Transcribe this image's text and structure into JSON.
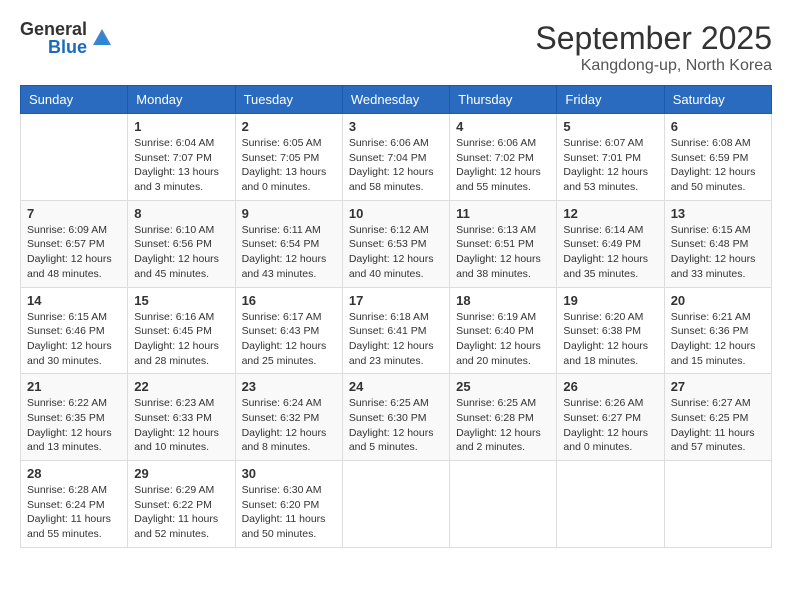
{
  "header": {
    "logo_general": "General",
    "logo_blue": "Blue",
    "month": "September 2025",
    "location": "Kangdong-up, North Korea"
  },
  "days_of_week": [
    "Sunday",
    "Monday",
    "Tuesday",
    "Wednesday",
    "Thursday",
    "Friday",
    "Saturday"
  ],
  "weeks": [
    [
      {
        "day": "",
        "info": ""
      },
      {
        "day": "1",
        "info": "Sunrise: 6:04 AM\nSunset: 7:07 PM\nDaylight: 13 hours\nand 3 minutes."
      },
      {
        "day": "2",
        "info": "Sunrise: 6:05 AM\nSunset: 7:05 PM\nDaylight: 13 hours\nand 0 minutes."
      },
      {
        "day": "3",
        "info": "Sunrise: 6:06 AM\nSunset: 7:04 PM\nDaylight: 12 hours\nand 58 minutes."
      },
      {
        "day": "4",
        "info": "Sunrise: 6:06 AM\nSunset: 7:02 PM\nDaylight: 12 hours\nand 55 minutes."
      },
      {
        "day": "5",
        "info": "Sunrise: 6:07 AM\nSunset: 7:01 PM\nDaylight: 12 hours\nand 53 minutes."
      },
      {
        "day": "6",
        "info": "Sunrise: 6:08 AM\nSunset: 6:59 PM\nDaylight: 12 hours\nand 50 minutes."
      }
    ],
    [
      {
        "day": "7",
        "info": "Sunrise: 6:09 AM\nSunset: 6:57 PM\nDaylight: 12 hours\nand 48 minutes."
      },
      {
        "day": "8",
        "info": "Sunrise: 6:10 AM\nSunset: 6:56 PM\nDaylight: 12 hours\nand 45 minutes."
      },
      {
        "day": "9",
        "info": "Sunrise: 6:11 AM\nSunset: 6:54 PM\nDaylight: 12 hours\nand 43 minutes."
      },
      {
        "day": "10",
        "info": "Sunrise: 6:12 AM\nSunset: 6:53 PM\nDaylight: 12 hours\nand 40 minutes."
      },
      {
        "day": "11",
        "info": "Sunrise: 6:13 AM\nSunset: 6:51 PM\nDaylight: 12 hours\nand 38 minutes."
      },
      {
        "day": "12",
        "info": "Sunrise: 6:14 AM\nSunset: 6:49 PM\nDaylight: 12 hours\nand 35 minutes."
      },
      {
        "day": "13",
        "info": "Sunrise: 6:15 AM\nSunset: 6:48 PM\nDaylight: 12 hours\nand 33 minutes."
      }
    ],
    [
      {
        "day": "14",
        "info": "Sunrise: 6:15 AM\nSunset: 6:46 PM\nDaylight: 12 hours\nand 30 minutes."
      },
      {
        "day": "15",
        "info": "Sunrise: 6:16 AM\nSunset: 6:45 PM\nDaylight: 12 hours\nand 28 minutes."
      },
      {
        "day": "16",
        "info": "Sunrise: 6:17 AM\nSunset: 6:43 PM\nDaylight: 12 hours\nand 25 minutes."
      },
      {
        "day": "17",
        "info": "Sunrise: 6:18 AM\nSunset: 6:41 PM\nDaylight: 12 hours\nand 23 minutes."
      },
      {
        "day": "18",
        "info": "Sunrise: 6:19 AM\nSunset: 6:40 PM\nDaylight: 12 hours\nand 20 minutes."
      },
      {
        "day": "19",
        "info": "Sunrise: 6:20 AM\nSunset: 6:38 PM\nDaylight: 12 hours\nand 18 minutes."
      },
      {
        "day": "20",
        "info": "Sunrise: 6:21 AM\nSunset: 6:36 PM\nDaylight: 12 hours\nand 15 minutes."
      }
    ],
    [
      {
        "day": "21",
        "info": "Sunrise: 6:22 AM\nSunset: 6:35 PM\nDaylight: 12 hours\nand 13 minutes."
      },
      {
        "day": "22",
        "info": "Sunrise: 6:23 AM\nSunset: 6:33 PM\nDaylight: 12 hours\nand 10 minutes."
      },
      {
        "day": "23",
        "info": "Sunrise: 6:24 AM\nSunset: 6:32 PM\nDaylight: 12 hours\nand 8 minutes."
      },
      {
        "day": "24",
        "info": "Sunrise: 6:25 AM\nSunset: 6:30 PM\nDaylight: 12 hours\nand 5 minutes."
      },
      {
        "day": "25",
        "info": "Sunrise: 6:25 AM\nSunset: 6:28 PM\nDaylight: 12 hours\nand 2 minutes."
      },
      {
        "day": "26",
        "info": "Sunrise: 6:26 AM\nSunset: 6:27 PM\nDaylight: 12 hours\nand 0 minutes."
      },
      {
        "day": "27",
        "info": "Sunrise: 6:27 AM\nSunset: 6:25 PM\nDaylight: 11 hours\nand 57 minutes."
      }
    ],
    [
      {
        "day": "28",
        "info": "Sunrise: 6:28 AM\nSunset: 6:24 PM\nDaylight: 11 hours\nand 55 minutes."
      },
      {
        "day": "29",
        "info": "Sunrise: 6:29 AM\nSunset: 6:22 PM\nDaylight: 11 hours\nand 52 minutes."
      },
      {
        "day": "30",
        "info": "Sunrise: 6:30 AM\nSunset: 6:20 PM\nDaylight: 11 hours\nand 50 minutes."
      },
      {
        "day": "",
        "info": ""
      },
      {
        "day": "",
        "info": ""
      },
      {
        "day": "",
        "info": ""
      },
      {
        "day": "",
        "info": ""
      }
    ]
  ]
}
